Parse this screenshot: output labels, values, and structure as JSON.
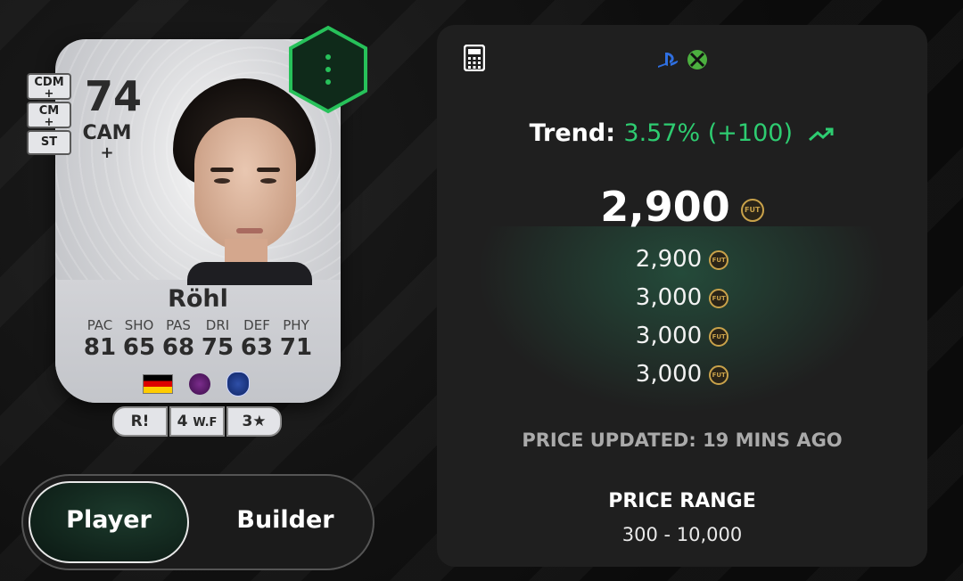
{
  "card": {
    "rating": "74",
    "position": "CAM",
    "position_plus": "+",
    "alt_positions": [
      {
        "label": "CDM",
        "plus": "+"
      },
      {
        "label": "CM",
        "plus": "+"
      },
      {
        "label": "ST",
        "plus": ""
      }
    ],
    "name": "Röhl",
    "stats": [
      {
        "label": "PAC",
        "value": "81"
      },
      {
        "label": "SHO",
        "value": "65"
      },
      {
        "label": "PAS",
        "value": "68"
      },
      {
        "label": "DRI",
        "value": "75"
      },
      {
        "label": "DEF",
        "value": "63"
      },
      {
        "label": "PHY",
        "value": "71"
      }
    ],
    "meta": {
      "role": "R!",
      "weak_foot": "4",
      "weak_foot_label": "W.F",
      "skill": "3★"
    },
    "icons": {
      "nation": "germany-flag",
      "league": "premier-league-icon",
      "club": "everton-crest-icon"
    }
  },
  "toggle": {
    "player": "Player",
    "builder": "Builder",
    "active": "Player"
  },
  "panel": {
    "trend_label": "Trend:",
    "trend_value": "3.57% (+100)",
    "trend_color": "#2ecc71",
    "main_price": "2,900",
    "coin_text": "FUT",
    "prices": [
      "2,900",
      "3,000",
      "3,000",
      "3,000"
    ],
    "updated": "PRICE UPDATED: 19 MINS AGO",
    "range_title": "PRICE RANGE",
    "range_value": "300 - 10,000",
    "icons": {
      "calculator": "calculator-icon",
      "platforms": [
        "playstation-icon",
        "xbox-icon"
      ],
      "trend": "trend-up-icon"
    }
  },
  "colors": {
    "accent_green": "#2ecc71",
    "hex_border": "#27c15a",
    "coin_gold": "#c9a24a"
  }
}
